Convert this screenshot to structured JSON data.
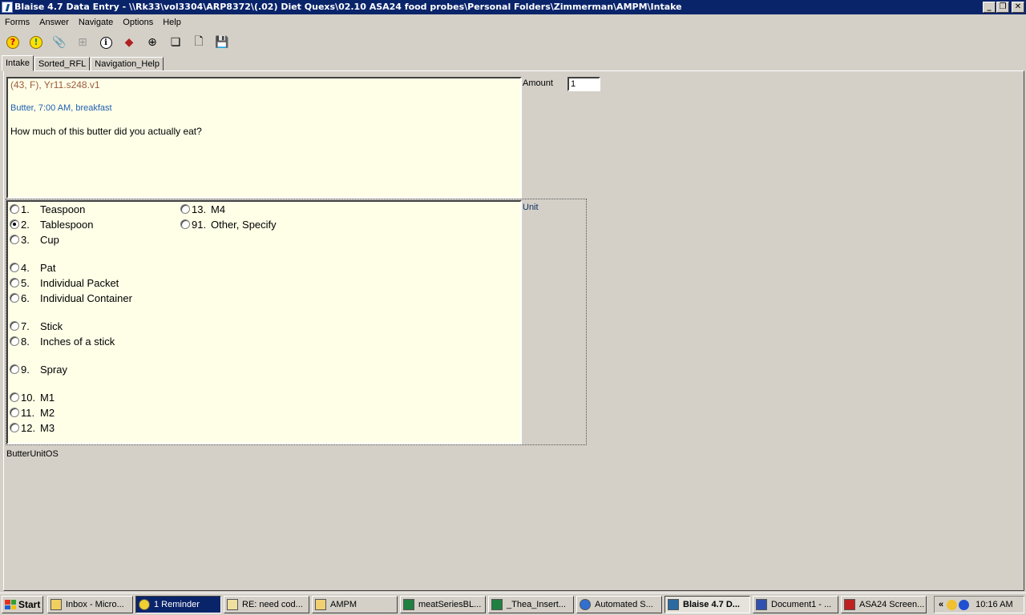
{
  "window": {
    "title": "Blaise 4.7 Data Entry - \\\\Rk33\\vol3304\\ARP8372\\(.02) Diet Quexs\\02.10 ASA24 food probes\\Personal Folders\\Zimmerman\\AMPM\\Intake",
    "minimize": "_",
    "restore": "❐",
    "close": "✕"
  },
  "menu": [
    "Forms",
    "Answer",
    "Navigate",
    "Options",
    "Help"
  ],
  "toolbar": {
    "help": "?",
    "alert": "!",
    "paperclip": "📎",
    "tree": "⊞",
    "info": "i",
    "tag": "◆",
    "binoculars": "⊕",
    "pages": "❏",
    "new": "🗋",
    "save": "💾"
  },
  "tabs": [
    "Intake",
    "Sorted_RFL",
    "Navigation_Help"
  ],
  "question": {
    "id": "(43, F),  Yr11.s248.v1",
    "context": "Butter, 7:00 AM, breakfast",
    "text": "How much of this butter did you actually eat?"
  },
  "amount": {
    "label": "Amount",
    "value": "1"
  },
  "unit_label": "Unit",
  "options": [
    {
      "num": "1.",
      "label": "Teaspoon",
      "checked": false
    },
    {
      "num": "2.",
      "label": "Tablespoon",
      "checked": true
    },
    {
      "num": "3.",
      "label": "Cup",
      "checked": false
    },
    {
      "num": "4.",
      "label": "Pat",
      "checked": false
    },
    {
      "num": "5.",
      "label": "Individual Packet",
      "checked": false
    },
    {
      "num": "6.",
      "label": "Individual Container",
      "checked": false
    },
    {
      "num": "7.",
      "label": "Stick",
      "checked": false
    },
    {
      "num": "8.",
      "label": "Inches of a stick",
      "checked": false
    },
    {
      "num": "9.",
      "label": "Spray",
      "checked": false
    },
    {
      "num": "10.",
      "label": "M1",
      "checked": false
    },
    {
      "num": "11.",
      "label": "M2",
      "checked": false
    },
    {
      "num": "12.",
      "label": "M3",
      "checked": false
    },
    {
      "num": "13.",
      "label": "M4",
      "checked": false
    },
    {
      "num": "91.",
      "label": "Other, Specify",
      "checked": false
    }
  ],
  "field_name": "ButterUnitOS",
  "taskbar": {
    "start": "Start",
    "tasks": [
      "Inbox - Micro...",
      "1 Reminder",
      "RE: need cod...",
      "AMPM",
      "meatSeriesBL...",
      "_Thea_Insert...",
      "Automated S...",
      "Blaise 4.7 D...",
      "Document1 - ...",
      "ASA24 Screen..."
    ],
    "tray_arrow": "«",
    "clock": "10:16 AM"
  }
}
